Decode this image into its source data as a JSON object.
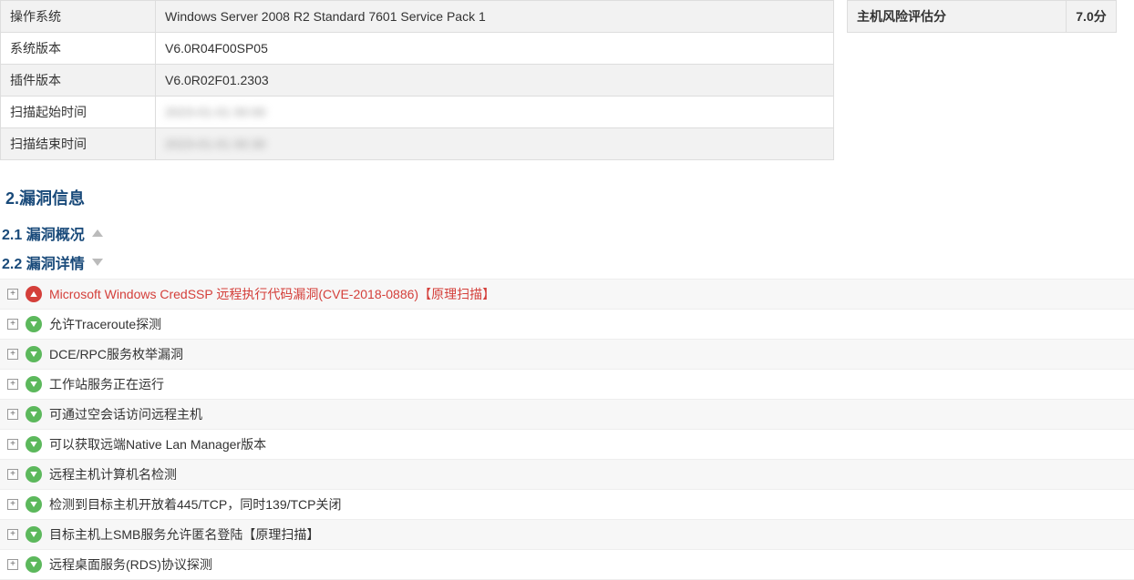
{
  "info_rows": [
    {
      "label": "操作系统",
      "value": "Windows Server 2008 R2 Standard 7601 Service Pack 1",
      "blurred": false
    },
    {
      "label": "系统版本",
      "value": "V6.0R04F00SP05",
      "blurred": false
    },
    {
      "label": "插件版本",
      "value": "V6.0R02F01.2303",
      "blurred": false
    },
    {
      "label": "扫描起始时间",
      "value": "2023-01-01 00:00",
      "blurred": true
    },
    {
      "label": "扫描结束时间",
      "value": "2023-01-01 00:30",
      "blurred": true
    }
  ],
  "score": {
    "label": "主机风险评估分",
    "value": "7.0分"
  },
  "section2": {
    "title": "2.漏洞信息"
  },
  "sub21": {
    "title": "2.1 漏洞概况",
    "collapsed": true
  },
  "sub22": {
    "title": "2.2 漏洞详情",
    "collapsed": false
  },
  "vulns": [
    {
      "sev": "high",
      "name": "Microsoft Windows CredSSP 远程执行代码漏洞(CVE-2018-0886)【原理扫描】"
    },
    {
      "sev": "low",
      "name": "允许Traceroute探测"
    },
    {
      "sev": "low",
      "name": "DCE/RPC服务枚举漏洞"
    },
    {
      "sev": "low",
      "name": "工作站服务正在运行"
    },
    {
      "sev": "low",
      "name": "可通过空会话访问远程主机"
    },
    {
      "sev": "low",
      "name": "可以获取远端Native Lan Manager版本"
    },
    {
      "sev": "low",
      "name": "远程主机计算机名检测"
    },
    {
      "sev": "low",
      "name": "检测到目标主机开放着445/TCP，同时139/TCP关闭"
    },
    {
      "sev": "low",
      "name": "目标主机上SMB服务允许匿名登陆【原理扫描】"
    },
    {
      "sev": "low",
      "name": "远程桌面服务(RDS)协议探测"
    }
  ]
}
